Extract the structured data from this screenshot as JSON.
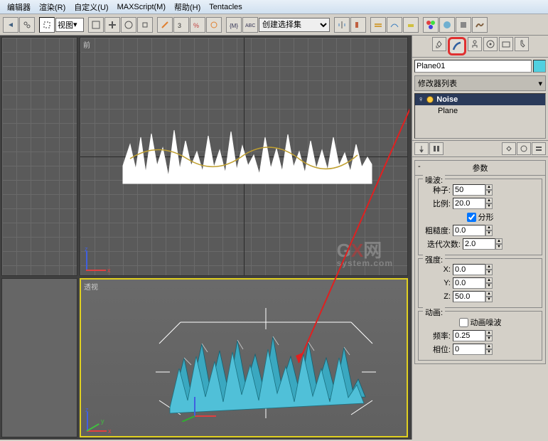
{
  "menu": {
    "editor": "编辑器",
    "render": "渲染(R)",
    "customize": "自定义(U)",
    "maxscript": "MAXScript(M)",
    "help": "帮助(H)",
    "tentacles": "Tentacles"
  },
  "toolbar": {
    "view_dropdown": "视图",
    "selection_set": "创建选择集"
  },
  "viewports": {
    "front_label": "前",
    "perspective_label": "透视"
  },
  "watermark": {
    "text1": "G",
    "text2": "网",
    "sub": "system.com"
  },
  "sidebar": {
    "object_name": "Plane01",
    "modifier_list_label": "修改器列表",
    "mod_noise": "Noise",
    "mod_plane": "Plane",
    "rollout_params_title": "参数",
    "group_noise": "噪波:",
    "seed_label": "种子:",
    "seed_value": "50",
    "scale_label": "比例:",
    "scale_value": "20.0",
    "fractal_label": "分形",
    "roughness_label": "粗糙度:",
    "roughness_value": "0.0",
    "iterations_label": "迭代次数:",
    "iterations_value": "2.0",
    "group_strength": "强度:",
    "x_label": "X:",
    "x_value": "0.0",
    "y_label": "Y:",
    "y_value": "0.0",
    "z_label": "Z:",
    "z_value": "50.0",
    "group_anim": "动画:",
    "anim_noise_label": "动画噪波",
    "freq_label": "频率:",
    "freq_value": "0.25",
    "phase_label": "相位:",
    "phase_value": "0"
  },
  "gizmo": {
    "x": "x",
    "y": "y",
    "z": "z"
  }
}
